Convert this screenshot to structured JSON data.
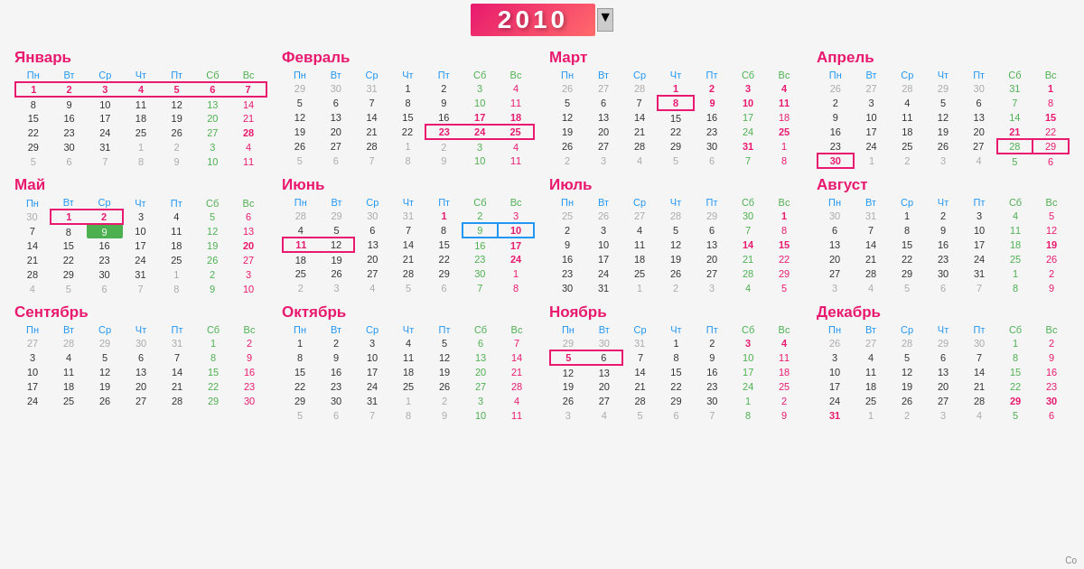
{
  "header": {
    "year": "2010",
    "dropdown_label": "▼"
  },
  "months": [
    {
      "name": "Январь"
    },
    {
      "name": "Февраль"
    },
    {
      "name": "Март"
    },
    {
      "name": "Апрель"
    },
    {
      "name": "Май"
    },
    {
      "name": "Июнь"
    },
    {
      "name": "Июль"
    },
    {
      "name": "Август"
    },
    {
      "name": "Сентябрь"
    },
    {
      "name": "Октябрь"
    },
    {
      "name": "Ноябрь"
    },
    {
      "name": "Декабрь"
    }
  ],
  "footer": {
    "text": "Co"
  }
}
